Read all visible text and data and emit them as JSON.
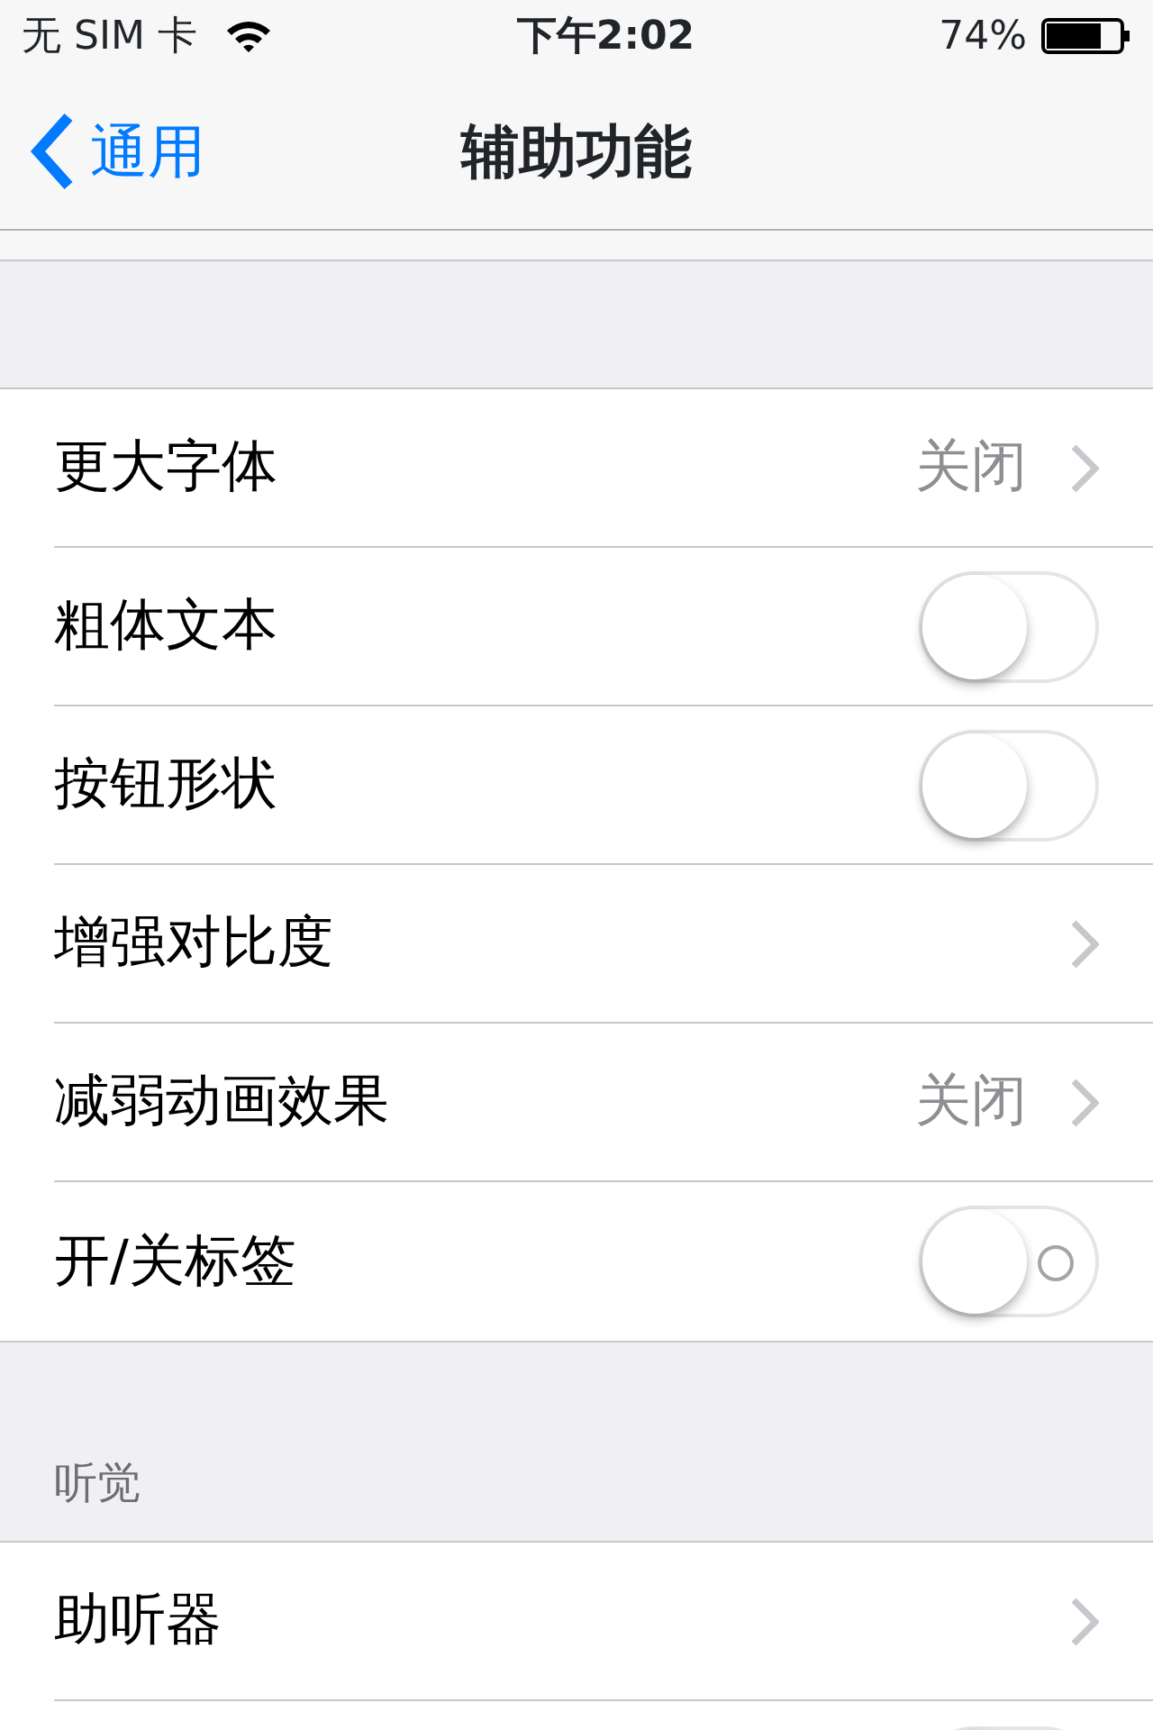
{
  "status_bar": {
    "carrier": "无 SIM 卡",
    "time": "下午2:02",
    "battery_text": "74%"
  },
  "nav_bar": {
    "back": "通用",
    "title": "辅助功能"
  },
  "sections": [
    {
      "rows": [
        {
          "kind": "link",
          "label": "更大字体",
          "value": "关闭"
        },
        {
          "kind": "toggle",
          "label": "粗体文本",
          "on": false
        },
        {
          "kind": "toggle",
          "label": "按钮形状",
          "on": false
        },
        {
          "kind": "link",
          "label": "增强对比度"
        },
        {
          "kind": "link",
          "label": "减弱动画效果",
          "value": "关闭"
        },
        {
          "kind": "toggle",
          "label": "开/关标签",
          "on": false,
          "show_label": true
        }
      ]
    },
    {
      "header": "听觉",
      "rows": [
        {
          "kind": "link",
          "label": "助听器"
        },
        {
          "kind": "toggle",
          "on": false
        }
      ]
    }
  ]
}
